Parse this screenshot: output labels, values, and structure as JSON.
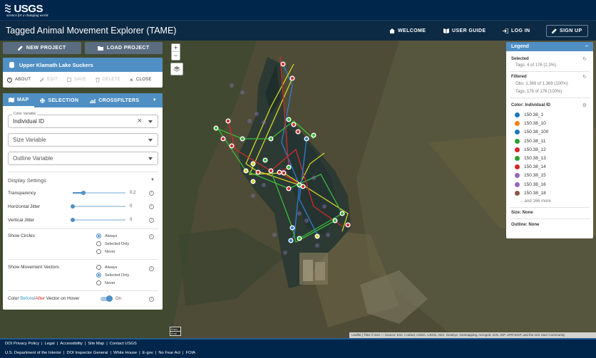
{
  "usgs": {
    "name": "USGS",
    "tagline": "science for a changing world"
  },
  "app": {
    "title": "Tagged Animal Movement Explorer (TAME)",
    "nav": {
      "welcome": "WELCOME",
      "user_guide": "USER GUIDE",
      "login": "LOG IN",
      "signup": "SIGN UP"
    }
  },
  "toolbar": {
    "new_project": "NEW PROJECT",
    "load_project": "LOAD PROJECT"
  },
  "project": {
    "name": "Upper Klamath Lake Suckers",
    "actions": {
      "about": "ABOUT",
      "edit": "EDIT",
      "save": "SAVE",
      "delete": "DELETE",
      "close": "CLOSE"
    }
  },
  "controls": {
    "tabs": {
      "map": "MAP",
      "selection": "SELECTION",
      "crossfilters": "CROSSFILTERS"
    },
    "color_variable": {
      "label": "Color Variable",
      "value": "Individual ID"
    },
    "size_variable": {
      "placeholder": "Size Variable"
    },
    "outline_variable": {
      "placeholder": "Outline Variable"
    },
    "display_settings": "Display Settings",
    "transparency": {
      "label": "Transparency",
      "value": "0.2",
      "level": 0.2
    },
    "h_jitter": {
      "label": "Horizontal Jitter",
      "value": "0",
      "level": 0
    },
    "v_jitter": {
      "label": "Vertical Jitter",
      "value": "0",
      "level": 0
    },
    "show_circles": {
      "label": "Show Circles",
      "options": [
        "Always",
        "Selected Only",
        "Never"
      ],
      "selected": "Always"
    },
    "show_vectors": {
      "label": "Show Movement Vectors",
      "options": [
        "Always",
        "Selected Only",
        "Never"
      ],
      "selected": "Selected Only"
    },
    "color_hover": {
      "prefix": "Color ",
      "before": "Before",
      "slash": "/",
      "after": "After",
      "suffix": " Vector on Hover",
      "state": "On"
    },
    "colors": {
      "before": "#2f9ad6",
      "after": "#d62728"
    }
  },
  "legend": {
    "title": "Legend",
    "selected": {
      "heading": "Selected",
      "tags": "Tags: 4 of 176 (2.3%)"
    },
    "filtered": {
      "heading": "Filtered",
      "obs": "Obs: 1,369 of 1,369 (100%)",
      "tags": "Tags: 176 of 176 (100%)"
    },
    "color_heading": "Color: Individual ID",
    "items": [
      {
        "label": "150.38_1",
        "color": "#1f77b4"
      },
      {
        "label": "150.38_10",
        "color": "#ff7f0e"
      },
      {
        "label": "150.38_100",
        "color": "#1f77b4"
      },
      {
        "label": "150.38_11",
        "color": "#2ca02c"
      },
      {
        "label": "150.38_12",
        "color": "#d62728"
      },
      {
        "label": "150.38_13",
        "color": "#2ca02c"
      },
      {
        "label": "150.38_14",
        "color": "#d62728"
      },
      {
        "label": "150.38_15",
        "color": "#9467bd"
      },
      {
        "label": "150.38_16",
        "color": "#9467bd"
      },
      {
        "label": "150.38_18",
        "color": "#8c564b"
      }
    ],
    "more": "... and 166 more",
    "size": "Size: None",
    "outline": "Outline: None"
  },
  "map": {
    "scale_km": "5 km",
    "scale_mi": "3 mi",
    "attribution": "Leaflet | Tiles © Esri — Source: Esri, i-cubed, USDA, USGS, AEX, GeoEye, Getmapping, Aerogrid, IGN, IGP, UPR-EGP, and the GIS User Community"
  },
  "footer": {
    "row1": [
      "DOI Privacy Policy",
      "Legal",
      "Accessibility",
      "Site Map",
      "Contact USGS"
    ],
    "row2": [
      "U.S. Department of the Interior",
      "DOI Inspector General",
      "White House",
      "E-gov",
      "No Fear Act",
      "FOIA"
    ]
  }
}
